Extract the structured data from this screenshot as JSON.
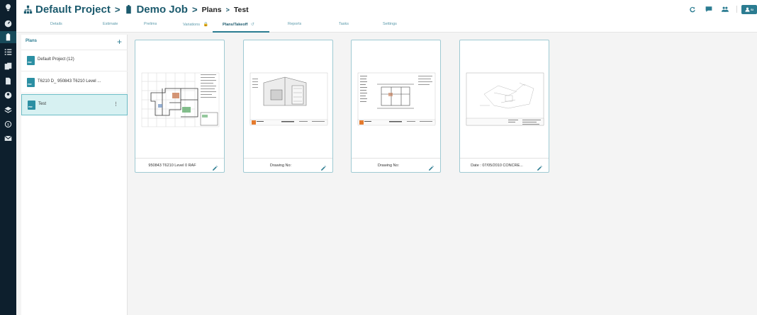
{
  "app": {
    "breadcrumb": {
      "project": "Default Project",
      "job": "Demo Job",
      "section": "Plans",
      "page": "Test",
      "separator": ">"
    },
    "tabs": [
      {
        "label": "Details"
      },
      {
        "label": "Estimate"
      },
      {
        "label": "Prelims"
      },
      {
        "label": "Variations"
      },
      {
        "label": "Plans/Takeoff"
      },
      {
        "label": "Reports"
      },
      {
        "label": "Tasks"
      },
      {
        "label": "Settings"
      }
    ],
    "active_tab": "Plans/Takeoff",
    "user_button_label": "Si"
  },
  "rail_icons": [
    "logo-icon",
    "dashboard-icon",
    "clipboard-icon",
    "checklist-icon",
    "documents-icon",
    "file-icon",
    "user-icon",
    "layers-icon",
    "support-icon",
    "mail-icon"
  ],
  "plans_panel": {
    "title": "Plans",
    "add_label": "+",
    "items": [
      {
        "label": "Default Project (12)",
        "badge": "PDF"
      },
      {
        "label": "T6210 D_ 950843 T6210 Level ...",
        "badge": "PDF"
      },
      {
        "label": "Test",
        "badge": "PDF",
        "more": "⋮"
      }
    ]
  },
  "cards": [
    {
      "label": "950843 T6210 Level 0 RAF"
    },
    {
      "label": "Drawing No:"
    },
    {
      "label": "Drawing No:"
    },
    {
      "label": "Date : 07/05/2010 CONCRE..."
    }
  ],
  "colors": {
    "rail": "#0d1f2d",
    "accent": "#2b7c91",
    "brand": "#1b5a6d",
    "selected_bg": "#d7f1f2"
  }
}
